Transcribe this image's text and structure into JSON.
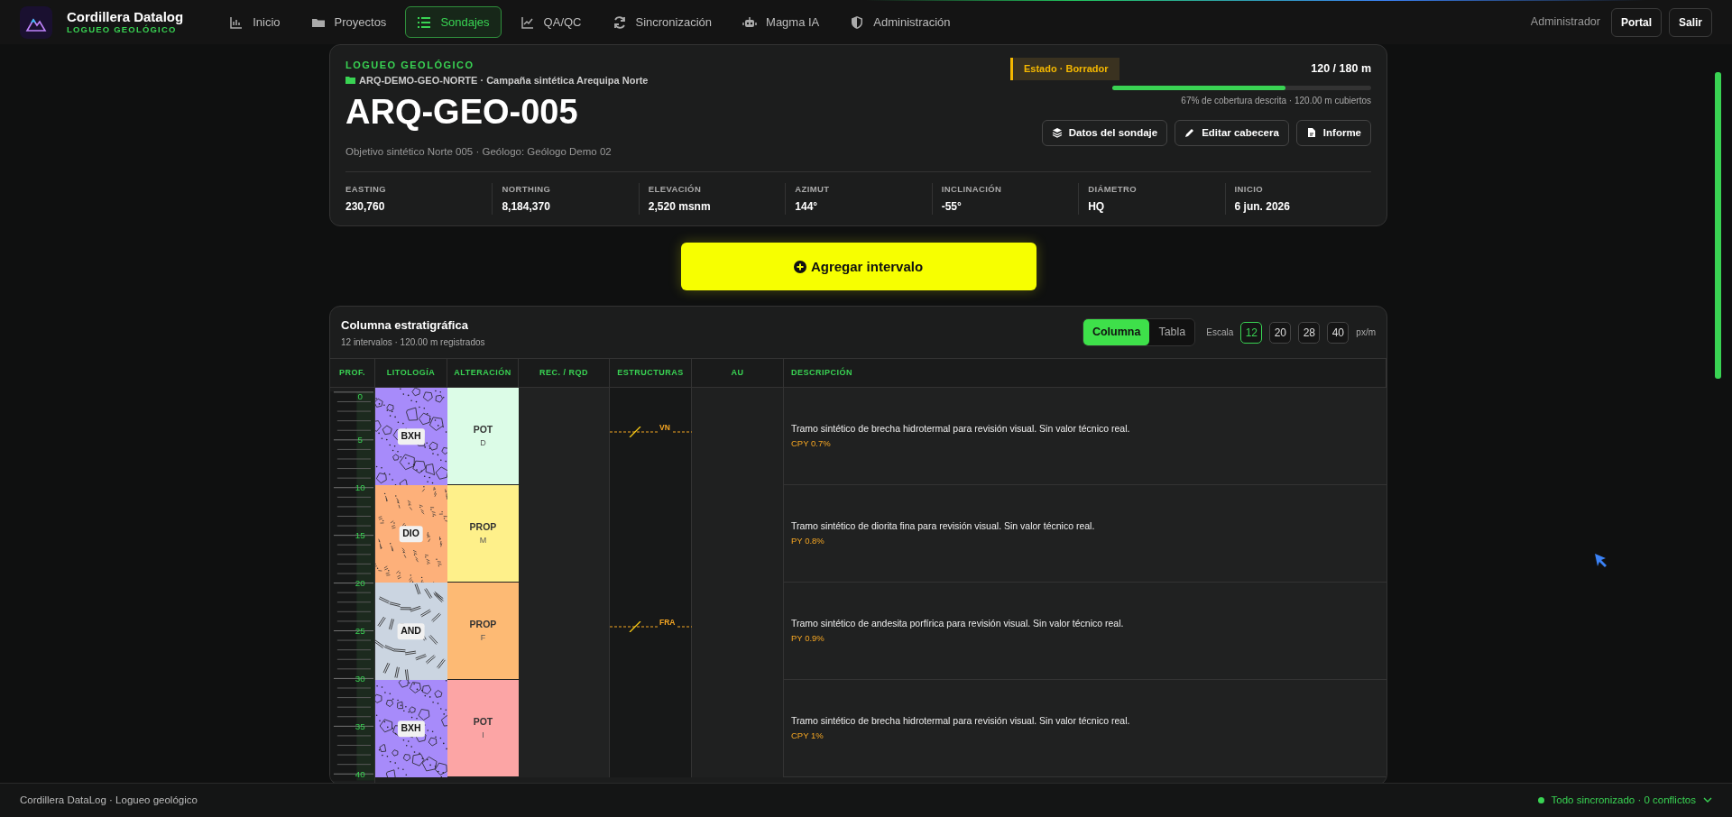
{
  "brand": {
    "name": "Cordillera Datalog",
    "tagline": "LOGUEO GEOLÓGICO"
  },
  "nav": [
    {
      "label": "Inicio",
      "selected": false
    },
    {
      "label": "Proyectos",
      "selected": false
    },
    {
      "label": "Sondajes",
      "selected": true
    },
    {
      "label": "QA/QC",
      "selected": false
    },
    {
      "label": "Sincronización",
      "selected": false
    },
    {
      "label": "Magma IA",
      "selected": false
    },
    {
      "label": "Administración",
      "selected": false
    }
  ],
  "user": {
    "role": "Administrador",
    "buttons": [
      "Portal",
      "Salir"
    ]
  },
  "header": {
    "eyebrow": "LOGUEO GEOLÓGICO",
    "campaign": "ARQ-DEMO-GEO-NORTE · Campaña sintética Arequipa Norte",
    "title": "ARQ-GEO-005",
    "subtitle": "Objetivo sintético Norte 005 · Geólogo: Geólogo Demo 02",
    "status": "Estado · Borrador",
    "meters": "120 / 180 m",
    "level": 0.67,
    "coverage": "67% de cobertura descrita · 120.00 m cubiertos",
    "buttons": [
      "Datos del sondaje",
      "Editar cabecera",
      "Informe"
    ],
    "stats": [
      {
        "label": "EASTING",
        "value": "230,760"
      },
      {
        "label": "NORTHING",
        "value": "8,184,370"
      },
      {
        "label": "ELEVACIÓN",
        "value": "2,520 msnm"
      },
      {
        "label": "AZIMUT",
        "value": "144°"
      },
      {
        "label": "INCLINACIÓN",
        "value": "-55°"
      },
      {
        "label": "DIÁMETRO",
        "value": "HQ"
      },
      {
        "label": "INICIO",
        "value": "6 jun. 2026"
      }
    ]
  },
  "add_button": "Agregar intervalo",
  "column": {
    "title": "Columna estratigráfica",
    "subtitle": "12 intervalos · 120.00 m registrados",
    "views": [
      {
        "label": "Columna",
        "selected": true
      },
      {
        "label": "Tabla",
        "selected": false
      }
    ],
    "scale_label": "Escala",
    "scales": [
      {
        "label": "12",
        "selected": true
      },
      {
        "label": "20",
        "selected": false
      },
      {
        "label": "28",
        "selected": false
      },
      {
        "label": "40",
        "selected": false
      }
    ],
    "scale_unit": "px/m",
    "columns": [
      "PROF.",
      "LITOLOGÍA",
      "ALTERACIÓN",
      "REC. / RQD",
      "ESTRUCTURAS",
      "AU",
      "DESCRIPCIÓN"
    ],
    "depth_labels": [
      "0",
      "5",
      "10",
      "15",
      "20",
      "25",
      "30",
      "35",
      "40"
    ],
    "intervals": [
      {
        "lithology": {
          "code": "BXH",
          "kind": "breccia",
          "color": "#a78bfa"
        },
        "alteration": {
          "code": "POT",
          "intensity": "D",
          "color": "#dcfce7"
        },
        "structure": {
          "code": "VN"
        },
        "description": "Tramo sintético de brecha hidrotermal para revisión visual. Sin valor técnico real.",
        "mineral": "CPY 0.7%"
      },
      {
        "lithology": {
          "code": "DIO",
          "kind": "speckled",
          "color": "#fdb07a"
        },
        "alteration": {
          "code": "PROP",
          "intensity": "M",
          "color": "#fef08a"
        },
        "description": "Tramo sintético de diorita fina para revisión visual. Sin valor técnico real.",
        "mineral": "PY 0.8%"
      },
      {
        "lithology": {
          "code": "AND",
          "kind": "tabular",
          "color": "#cbd5e1"
        },
        "alteration": {
          "code": "PROP",
          "intensity": "F",
          "color": "#fdba74"
        },
        "structure": {
          "code": "FRA"
        },
        "description": "Tramo sintético de andesita porfírica para revisión visual. Sin valor técnico real.",
        "mineral": "PY 0.9%"
      },
      {
        "lithology": {
          "code": "BXH",
          "kind": "breccia",
          "color": "#a78bfa"
        },
        "alteration": {
          "code": "POT",
          "intensity": "I",
          "color": "#fca5a5"
        },
        "description": "Tramo sintético de brecha hidrotermal para revisión visual. Sin valor técnico real.",
        "mineral": "CPY 1%"
      }
    ]
  },
  "footer": {
    "left": "Cordillera DataLog · Logueo geológico",
    "sync": "Todo sincronizado · 0 conflictos"
  }
}
